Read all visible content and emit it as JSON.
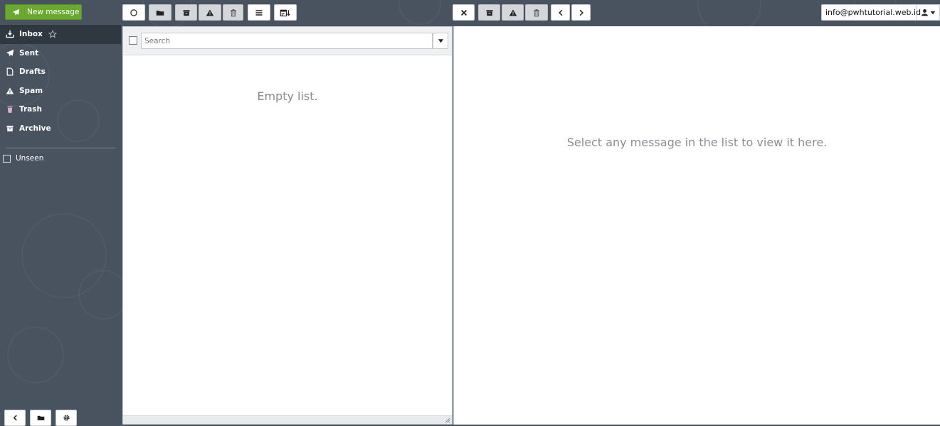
{
  "compose": {
    "label": "New message",
    "icon": "paper-plane-icon"
  },
  "toolbar_left": [
    {
      "name": "refresh-button",
      "icon": "refresh-icon"
    },
    {
      "name": "move-to-folder-button",
      "icon": "folder-icon"
    },
    {
      "name": "archive-button",
      "icon": "archive-icon"
    },
    {
      "name": "spam-button",
      "icon": "warning-icon"
    },
    {
      "name": "delete-button",
      "icon": "trash-icon"
    },
    {
      "name": "more-menu-button",
      "icon": "menu-icon"
    },
    {
      "name": "sort-button",
      "icon": "calendar-sort-icon"
    }
  ],
  "toolbar_right": [
    {
      "name": "close-preview-button",
      "icon": "close-icon"
    },
    {
      "name": "archive-message-button",
      "icon": "archive-icon"
    },
    {
      "name": "spam-message-button",
      "icon": "warning-icon"
    },
    {
      "name": "delete-message-button",
      "icon": "trash-icon"
    },
    {
      "name": "previous-message-button",
      "icon": "chevron-left-icon"
    },
    {
      "name": "next-message-button",
      "icon": "chevron-right-icon"
    }
  ],
  "account": {
    "email": "info@pwhtutorial.web.id",
    "icon": "user-icon"
  },
  "sidebar": {
    "folders": [
      {
        "label": "Inbox",
        "icon": "inbox-icon",
        "active": true
      },
      {
        "label": "Sent",
        "icon": "paper-plane-icon"
      },
      {
        "label": "Drafts",
        "icon": "file-icon"
      },
      {
        "label": "Spam",
        "icon": "warning-icon"
      },
      {
        "label": "Trash",
        "icon": "trash-icon"
      },
      {
        "label": "Archive",
        "icon": "archive-icon"
      }
    ],
    "filter_label": "Unseen",
    "bottom_buttons": [
      "collapse-sidebar-button",
      "folders-button",
      "settings-button"
    ]
  },
  "message_list": {
    "search_placeholder": "Search",
    "empty_text": "Empty list."
  },
  "preview": {
    "empty_text": "Select any message in the list to view it here."
  },
  "colors": {
    "background": "#48535f",
    "sidebar_active": "#2f3741",
    "compose_green": "#6aa830",
    "panel": "#ffffff"
  }
}
